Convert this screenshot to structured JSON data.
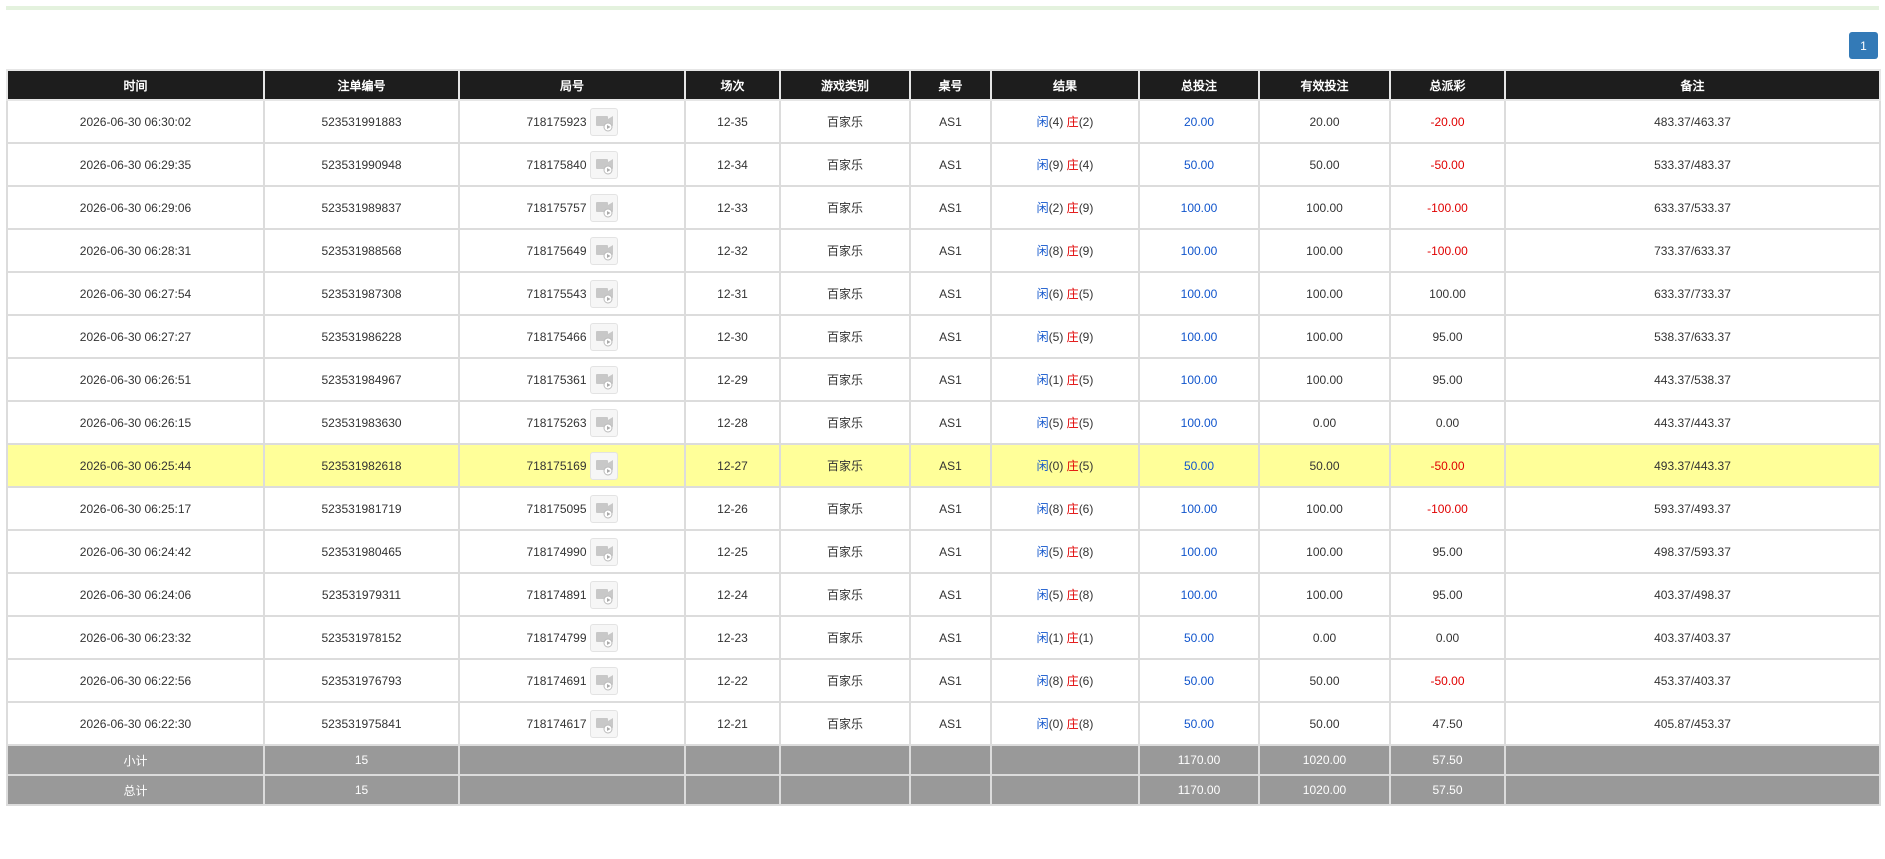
{
  "pagination": {
    "current_page": "1"
  },
  "columns": [
    "时间",
    "注单编号",
    "局号",
    "场次",
    "游戏类别",
    "桌号",
    "结果",
    "总投注",
    "有效投注",
    "总派彩",
    "备注"
  ],
  "rows": [
    {
      "time": "2026-06-30 06:30:02",
      "bet_id": "523531991883",
      "round": "718175923",
      "session": "12-35",
      "game": "百家乐",
      "table": "AS1",
      "player_label": "闲",
      "player_score": "(4)",
      "banker_label": "庄",
      "banker_score": "(2)",
      "total_bet": "20.00",
      "valid_bet": "20.00",
      "payout": "-20.00",
      "note": "483.37/463.37"
    },
    {
      "time": "2026-06-30 06:29:35",
      "bet_id": "523531990948",
      "round": "718175840",
      "session": "12-34",
      "game": "百家乐",
      "table": "AS1",
      "player_label": "闲",
      "player_score": "(9)",
      "banker_label": "庄",
      "banker_score": "(4)",
      "total_bet": "50.00",
      "valid_bet": "50.00",
      "payout": "-50.00",
      "note": "533.37/483.37"
    },
    {
      "time": "2026-06-30 06:29:06",
      "bet_id": "523531989837",
      "round": "718175757",
      "session": "12-33",
      "game": "百家乐",
      "table": "AS1",
      "player_label": "闲",
      "player_score": "(2)",
      "banker_label": "庄",
      "banker_score": "(9)",
      "total_bet": "100.00",
      "valid_bet": "100.00",
      "payout": "-100.00",
      "note": "633.37/533.37"
    },
    {
      "time": "2026-06-30 06:28:31",
      "bet_id": "523531988568",
      "round": "718175649",
      "session": "12-32",
      "game": "百家乐",
      "table": "AS1",
      "player_label": "闲",
      "player_score": "(8)",
      "banker_label": "庄",
      "banker_score": "(9)",
      "total_bet": "100.00",
      "valid_bet": "100.00",
      "payout": "-100.00",
      "note": "733.37/633.37"
    },
    {
      "time": "2026-06-30 06:27:54",
      "bet_id": "523531987308",
      "round": "718175543",
      "session": "12-31",
      "game": "百家乐",
      "table": "AS1",
      "player_label": "闲",
      "player_score": "(6)",
      "banker_label": "庄",
      "banker_score": "(5)",
      "total_bet": "100.00",
      "valid_bet": "100.00",
      "payout": "100.00",
      "note": "633.37/733.37"
    },
    {
      "time": "2026-06-30 06:27:27",
      "bet_id": "523531986228",
      "round": "718175466",
      "session": "12-30",
      "game": "百家乐",
      "table": "AS1",
      "player_label": "闲",
      "player_score": "(5)",
      "banker_label": "庄",
      "banker_score": "(9)",
      "total_bet": "100.00",
      "valid_bet": "100.00",
      "payout": "95.00",
      "note": "538.37/633.37"
    },
    {
      "time": "2026-06-30 06:26:51",
      "bet_id": "523531984967",
      "round": "718175361",
      "session": "12-29",
      "game": "百家乐",
      "table": "AS1",
      "player_label": "闲",
      "player_score": "(1)",
      "banker_label": "庄",
      "banker_score": "(5)",
      "total_bet": "100.00",
      "valid_bet": "100.00",
      "payout": "95.00",
      "note": "443.37/538.37"
    },
    {
      "time": "2026-06-30 06:26:15",
      "bet_id": "523531983630",
      "round": "718175263",
      "session": "12-28",
      "game": "百家乐",
      "table": "AS1",
      "player_label": "闲",
      "player_score": "(5)",
      "banker_label": "庄",
      "banker_score": "(5)",
      "total_bet": "100.00",
      "valid_bet": "0.00",
      "payout": "0.00",
      "note": "443.37/443.37"
    },
    {
      "time": "2026-06-30 06:25:44",
      "bet_id": "523531982618",
      "round": "718175169",
      "session": "12-27",
      "game": "百家乐",
      "table": "AS1",
      "player_label": "闲",
      "player_score": "(0)",
      "banker_label": "庄",
      "banker_score": "(5)",
      "total_bet": "50.00",
      "valid_bet": "50.00",
      "payout": "-50.00",
      "note": "493.37/443.37",
      "highlight": true
    },
    {
      "time": "2026-06-30 06:25:17",
      "bet_id": "523531981719",
      "round": "718175095",
      "session": "12-26",
      "game": "百家乐",
      "table": "AS1",
      "player_label": "闲",
      "player_score": "(8)",
      "banker_label": "庄",
      "banker_score": "(6)",
      "total_bet": "100.00",
      "valid_bet": "100.00",
      "payout": "-100.00",
      "note": "593.37/493.37"
    },
    {
      "time": "2026-06-30 06:24:42",
      "bet_id": "523531980465",
      "round": "718174990",
      "session": "12-25",
      "game": "百家乐",
      "table": "AS1",
      "player_label": "闲",
      "player_score": "(5)",
      "banker_label": "庄",
      "banker_score": "(8)",
      "total_bet": "100.00",
      "valid_bet": "100.00",
      "payout": "95.00",
      "note": "498.37/593.37"
    },
    {
      "time": "2026-06-30 06:24:06",
      "bet_id": "523531979311",
      "round": "718174891",
      "session": "12-24",
      "game": "百家乐",
      "table": "AS1",
      "player_label": "闲",
      "player_score": "(5)",
      "banker_label": "庄",
      "banker_score": "(8)",
      "total_bet": "100.00",
      "valid_bet": "100.00",
      "payout": "95.00",
      "note": "403.37/498.37"
    },
    {
      "time": "2026-06-30 06:23:32",
      "bet_id": "523531978152",
      "round": "718174799",
      "session": "12-23",
      "game": "百家乐",
      "table": "AS1",
      "player_label": "闲",
      "player_score": "(1)",
      "banker_label": "庄",
      "banker_score": "(1)",
      "total_bet": "50.00",
      "valid_bet": "0.00",
      "payout": "0.00",
      "note": "403.37/403.37"
    },
    {
      "time": "2026-06-30 06:22:56",
      "bet_id": "523531976793",
      "round": "718174691",
      "session": "12-22",
      "game": "百家乐",
      "table": "AS1",
      "player_label": "闲",
      "player_score": "(8)",
      "banker_label": "庄",
      "banker_score": "(6)",
      "total_bet": "50.00",
      "valid_bet": "50.00",
      "payout": "-50.00",
      "note": "453.37/403.37"
    },
    {
      "time": "2026-06-30 06:22:30",
      "bet_id": "523531975841",
      "round": "718174617",
      "session": "12-21",
      "game": "百家乐",
      "table": "AS1",
      "player_label": "闲",
      "player_score": "(0)",
      "banker_label": "庄",
      "banker_score": "(8)",
      "total_bet": "50.00",
      "valid_bet": "50.00",
      "payout": "47.50",
      "note": "405.87/453.37"
    }
  ],
  "footer": {
    "subtotal": {
      "label": "小计",
      "count": "15",
      "total_bet": "1170.00",
      "valid_bet": "1020.00",
      "payout": "57.50"
    },
    "total": {
      "label": "总计",
      "count": "15",
      "total_bet": "1170.00",
      "valid_bet": "1020.00",
      "payout": "57.50"
    }
  },
  "colors": {
    "header_bg": "#1d1d1d",
    "highlight_row": "#ffff99",
    "footer_bg": "#999999",
    "negative": "#e00000",
    "bet_blue": "#1155cc",
    "pager": "#337ab7"
  },
  "icons": {
    "replay": "replay-video-icon"
  }
}
